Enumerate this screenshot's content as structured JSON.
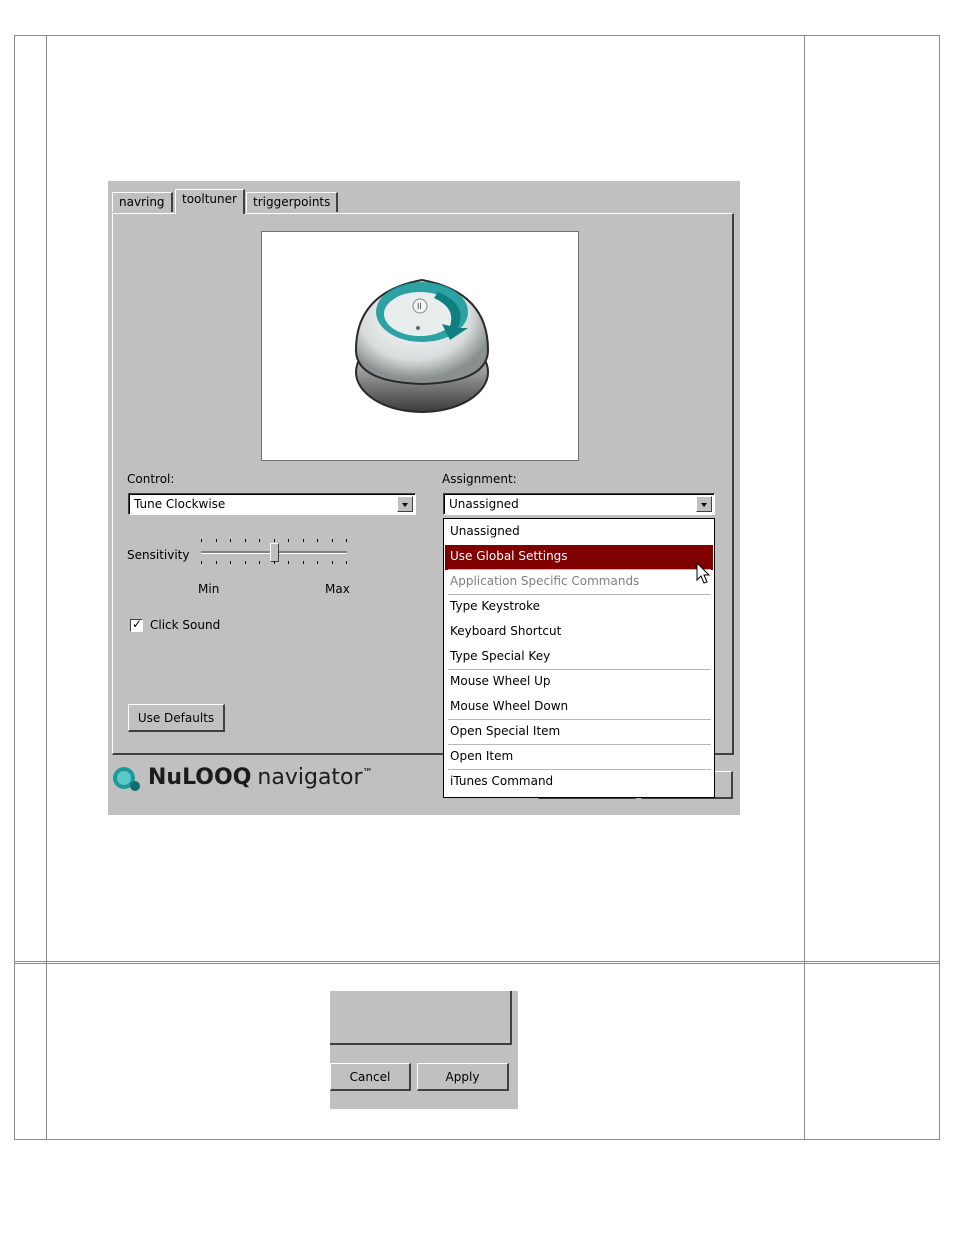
{
  "tabs": [
    {
      "label": "navring"
    },
    {
      "label": "tooltuner"
    },
    {
      "label": "triggerpoints"
    }
  ],
  "control": {
    "label": "Control:",
    "value": "Tune Clockwise"
  },
  "assignment": {
    "label": "Assignment:",
    "value": "Unassigned"
  },
  "sensitivity": {
    "label": "Sensitivity",
    "min_label": "Min",
    "max_label": "Max",
    "level": 0.5
  },
  "click_sound": {
    "label": "Click Sound",
    "checked": true,
    "check_glyph": "✓"
  },
  "use_defaults": {
    "label": "Use Defaults"
  },
  "dropdown": {
    "items": [
      {
        "label": "Unassigned"
      },
      {
        "label": "Use Global Settings"
      },
      {
        "label": "Application Specific Commands"
      },
      {
        "label": "Type Keystroke"
      },
      {
        "label": "Keyboard Shortcut"
      },
      {
        "label": "Type Special Key"
      },
      {
        "label": "Mouse Wheel Up"
      },
      {
        "label": "Mouse Wheel Down"
      },
      {
        "label": "Open Special Item"
      },
      {
        "label": "Open Item"
      },
      {
        "label": "iTunes Command"
      }
    ],
    "selected": "Use Global Settings",
    "disabled": [
      "Application Specific Commands"
    ]
  },
  "logo": {
    "brand": "NuLOOQ",
    "product": "navigator",
    "tm": "™"
  },
  "bottom_buttons": {
    "cancel": "Cancel",
    "apply": "Apply"
  },
  "colors": {
    "dialog_bg": "#c0c0c0",
    "selection": "#800000",
    "teal_accent": "#1a9a9a"
  }
}
